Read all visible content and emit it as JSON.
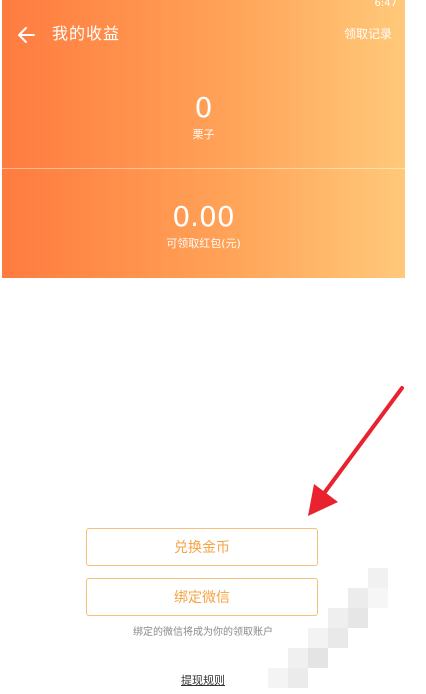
{
  "header": {
    "title": "我的收益",
    "records_label": "领取记录",
    "status_time": "6:47"
  },
  "stats": {
    "beans_value": "0",
    "beans_label": "栗子",
    "redpacket_value": "0.00",
    "redpacket_label": "可领取红包(元)"
  },
  "actions": {
    "exchange_label": "兑换金币",
    "bind_label": "绑定微信",
    "bind_note": "绑定的微信将成为你的领取账户",
    "rules_label": "提现规则"
  },
  "colors": {
    "header_start": "#ff7b3f",
    "header_end": "#ffc97a",
    "button_border": "#f5c17a",
    "button_text": "#f5a443",
    "annotation_arrow": "#e8232f"
  },
  "icons": {
    "back": "arrow-left-icon"
  }
}
